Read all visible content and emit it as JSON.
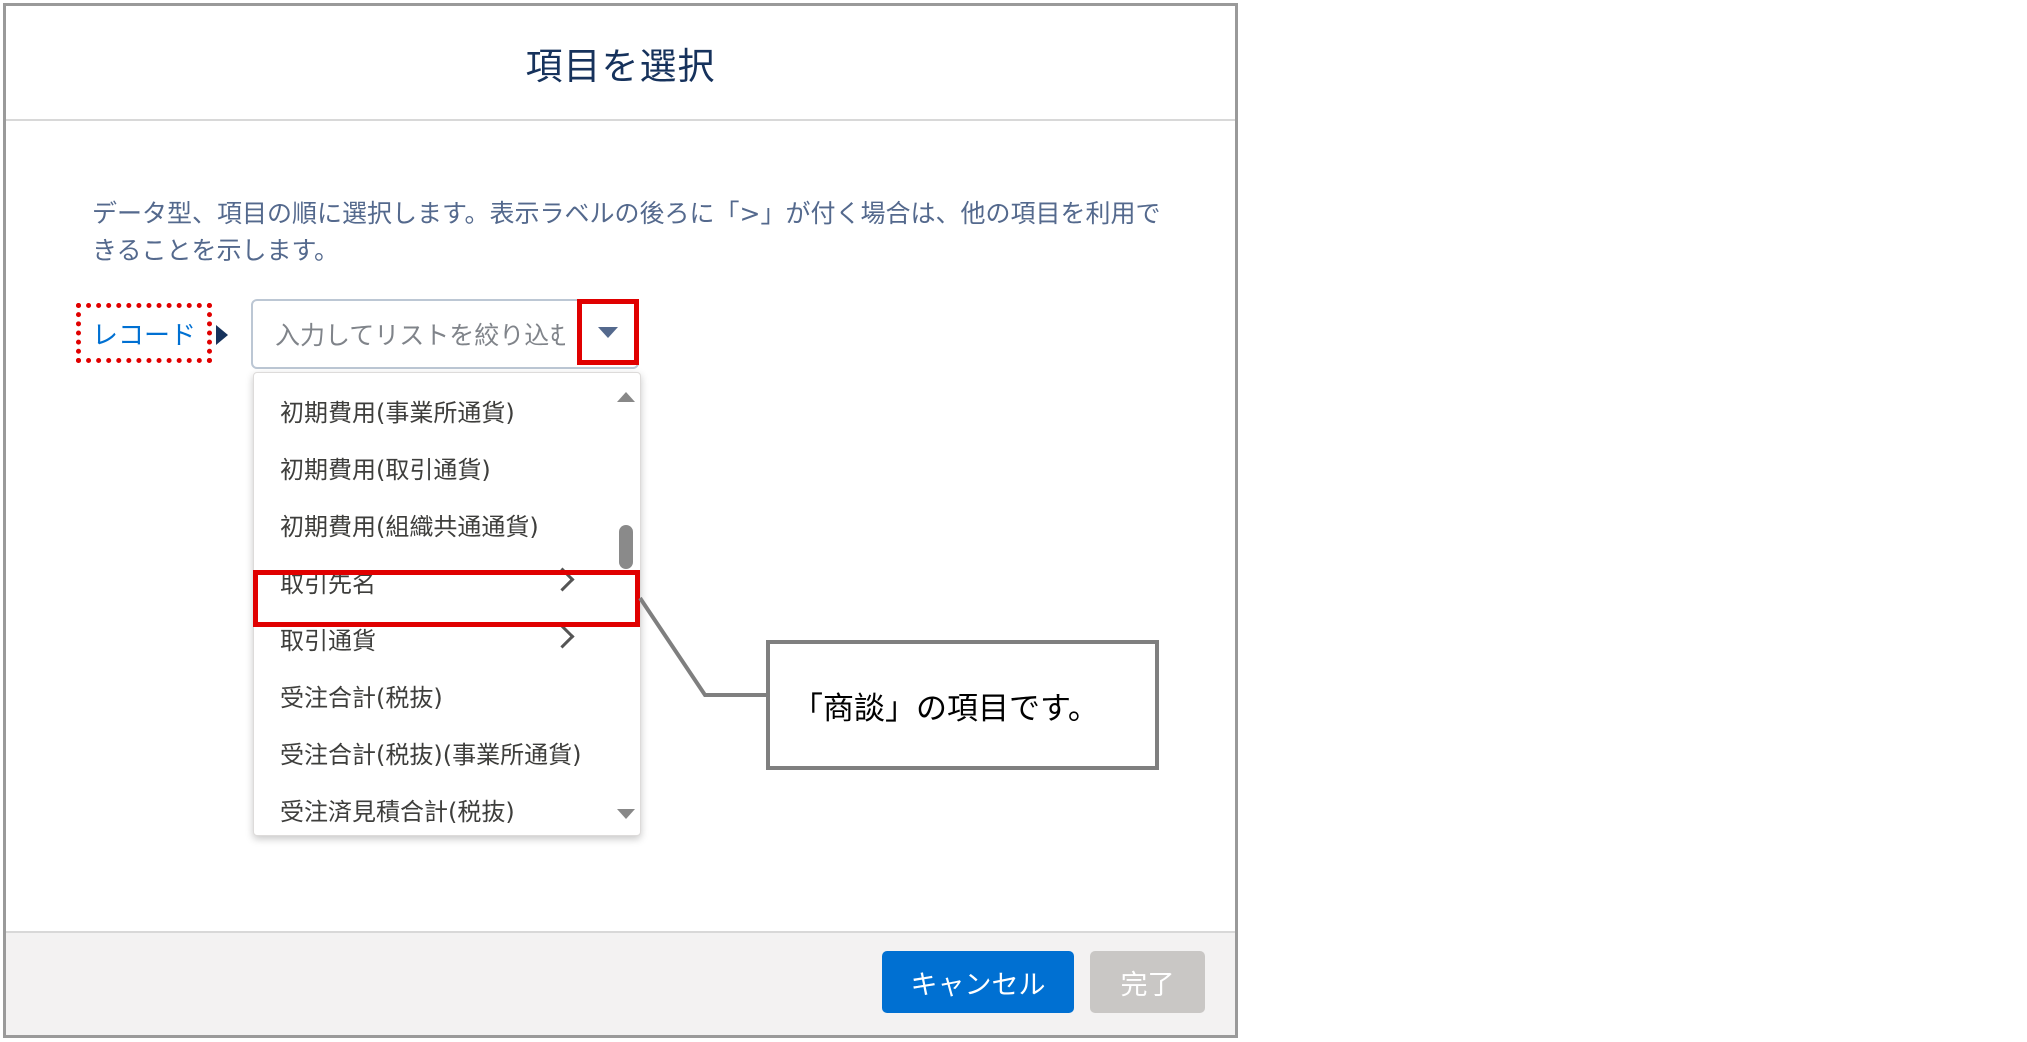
{
  "modal": {
    "title": "項目を選択",
    "description": "データ型、項目の順に選択します。表示ラベルの後ろに「>」が付く場合は、他の項目を利用できることを示します。"
  },
  "record": {
    "label": "レコード"
  },
  "combobox": {
    "placeholder": "入力してリストを絞り込む",
    "dropdown_icon": "chevron-down-icon"
  },
  "listbox": {
    "items": [
      {
        "label": "初期費用(事業所通貨)",
        "has_submenu": false
      },
      {
        "label": "初期費用(取引通貨)",
        "has_submenu": false
      },
      {
        "label": "初期費用(組織共通通貨)",
        "has_submenu": false
      },
      {
        "label": "取引先名",
        "has_submenu": true,
        "highlighted": true
      },
      {
        "label": "取引通貨",
        "has_submenu": true
      },
      {
        "label": "受注合計(税抜)",
        "has_submenu": false
      },
      {
        "label": "受注合計(税抜)(事業所通貨)",
        "has_submenu": false
      },
      {
        "label": "受注済見積合計(税抜)",
        "has_submenu": false
      }
    ]
  },
  "callout": {
    "text": "「商談」の項目です。"
  },
  "footer": {
    "cancel_label": "キャンセル",
    "done_label": "完了"
  },
  "colors": {
    "brand": "#0070d2",
    "annotation_red": "#e00000",
    "title": "#16325c",
    "disabled": "#c9c7c5"
  }
}
